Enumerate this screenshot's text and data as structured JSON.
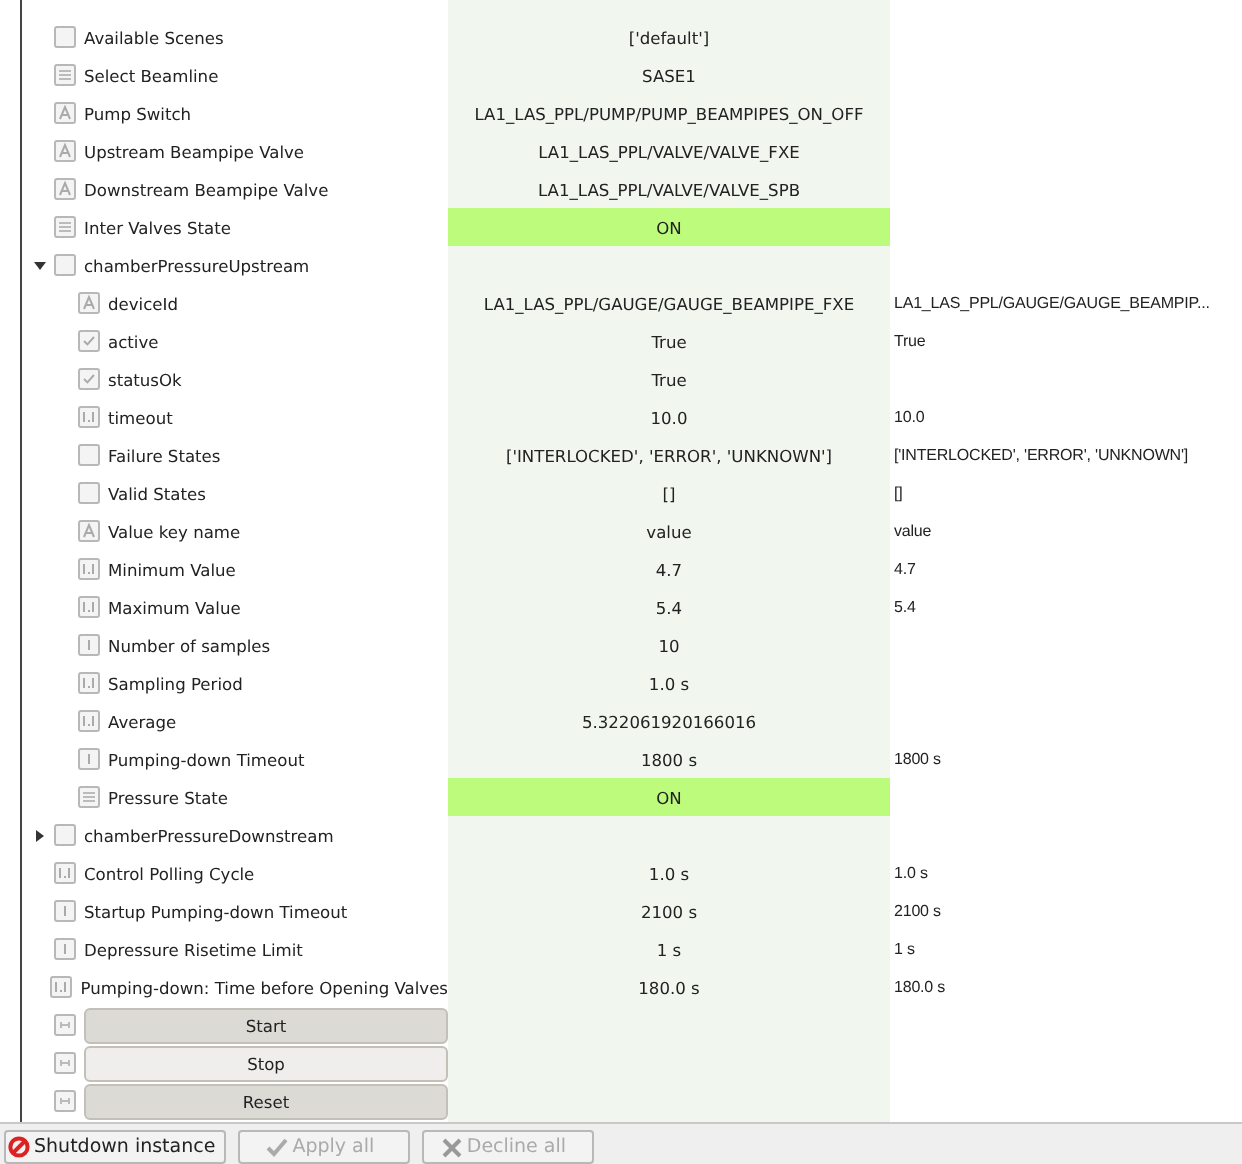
{
  "rows": [
    {
      "label": "Available Scenes",
      "kind": "node",
      "value": "['default']"
    },
    {
      "label": "Select Beamline",
      "kind": "list",
      "value": "SASE1"
    },
    {
      "label": "Pump Switch",
      "kind": "string",
      "value": "LA1_LAS_PPL/PUMP/PUMP_BEAMPIPES_ON_OFF"
    },
    {
      "label": "Upstream Beampipe Valve",
      "kind": "string",
      "value": "LA1_LAS_PPL/VALVE/VALVE_FXE"
    },
    {
      "label": "Downstream Beampipe Valve",
      "kind": "string",
      "value": "LA1_LAS_PPL/VALVE/VALVE_SPB"
    },
    {
      "label": "Inter Valves State",
      "kind": "list",
      "value": "ON",
      "highlight": true
    },
    {
      "label": "chamberPressureUpstream",
      "kind": "node",
      "expanded": true,
      "children": [
        {
          "label": "deviceId",
          "kind": "string",
          "value": "LA1_LAS_PPL/GAUGE/GAUGE_BEAMPIPE_FXE",
          "edit_value": "LA1_LAS_PPL/GAUGE/GAUGE_BEAMPIP..."
        },
        {
          "label": "active",
          "kind": "bool",
          "value": "True",
          "edit_value": "True"
        },
        {
          "label": "statusOk",
          "kind": "bool",
          "value": "True"
        },
        {
          "label": "timeout",
          "kind": "float",
          "value": "10.0",
          "edit_value": "10.0"
        },
        {
          "label": "Failure States",
          "kind": "node",
          "value": "['INTERLOCKED', 'ERROR', 'UNKNOWN']",
          "edit_value": "['INTERLOCKED', 'ERROR', 'UNKNOWN']"
        },
        {
          "label": "Valid States",
          "kind": "node",
          "value": "[]",
          "edit_value": "[]"
        },
        {
          "label": "Value key name",
          "kind": "string",
          "value": "value",
          "edit_value": "value"
        },
        {
          "label": "Minimum Value",
          "kind": "float",
          "value": "4.7",
          "edit_value": "4.7"
        },
        {
          "label": "Maximum Value",
          "kind": "float",
          "value": "5.4",
          "edit_value": "5.4"
        },
        {
          "label": "Number of samples",
          "kind": "int",
          "value": "10"
        },
        {
          "label": "Sampling Period",
          "kind": "float",
          "value": "1.0 s"
        },
        {
          "label": "Average",
          "kind": "float",
          "value": "5.322061920166016"
        },
        {
          "label": "Pumping-down Timeout",
          "kind": "int",
          "value": "1800 s",
          "edit_value": "1800 s"
        },
        {
          "label": "Pressure State",
          "kind": "list",
          "value": "ON",
          "highlight": true
        }
      ]
    },
    {
      "label": "chamberPressureDownstream",
      "kind": "node",
      "expanded": false
    },
    {
      "label": "Control Polling Cycle",
      "kind": "float",
      "value": "1.0 s",
      "edit_value": "1.0 s"
    },
    {
      "label": "Startup Pumping-down Timeout",
      "kind": "int",
      "value": "2100 s",
      "edit_value": "2100 s"
    },
    {
      "label": "Depressure Risetime Limit",
      "kind": "int",
      "value": "1 s",
      "edit_value": "1 s"
    },
    {
      "label": "Pumping-down: Time before Opening Valves",
      "kind": "float",
      "value": "180.0 s",
      "edit_value": "180.0 s"
    }
  ],
  "commands": [
    {
      "label": "Start",
      "hovered": false
    },
    {
      "label": "Stop",
      "hovered": true
    },
    {
      "label": "Reset",
      "hovered": false
    }
  ],
  "footer": [
    {
      "label": "Shutdown instance",
      "kind": "shutdown",
      "disabled": false
    },
    {
      "label": "Apply all",
      "kind": "apply",
      "disabled": true
    },
    {
      "label": "Decline all",
      "kind": "decline",
      "disabled": true
    }
  ]
}
